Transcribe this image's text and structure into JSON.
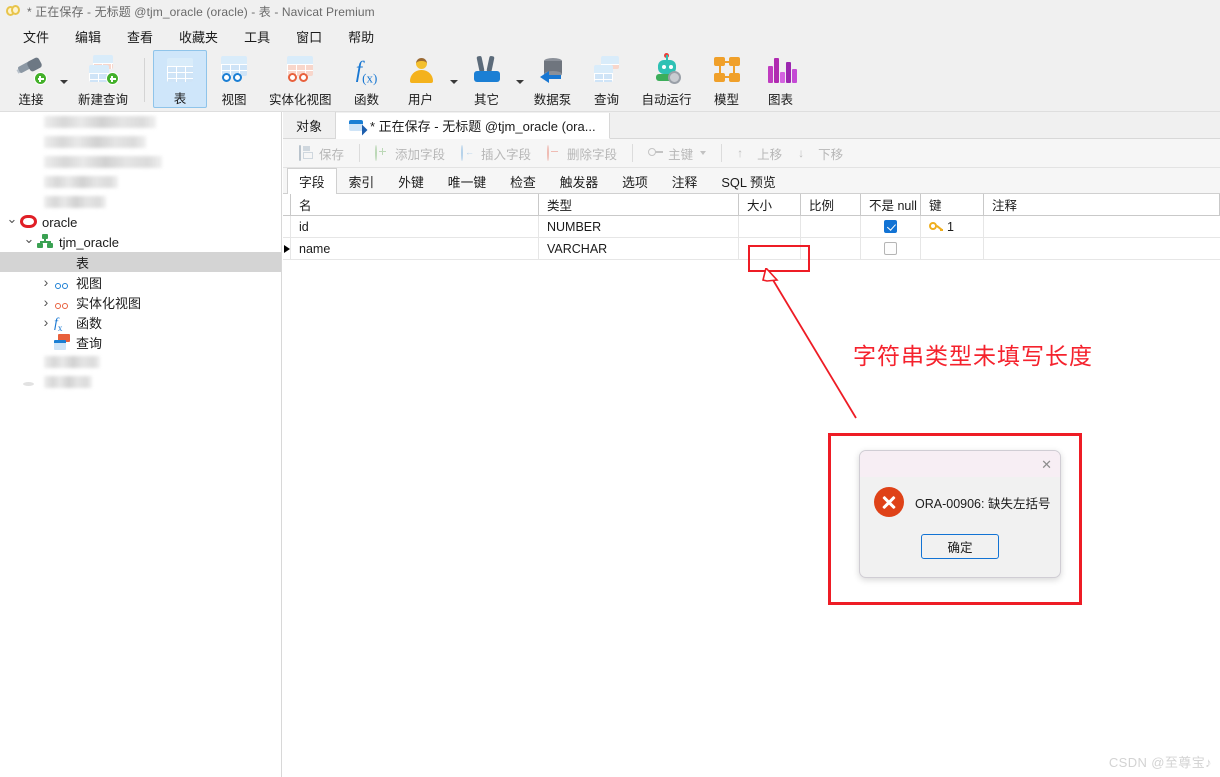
{
  "window": {
    "title": "* 正在保存 - 无标题 @tjm_oracle (oracle) - 表 - Navicat Premium",
    "logo_icon": "navicat-logo-icon"
  },
  "menubar": {
    "items": [
      {
        "label": "文件"
      },
      {
        "label": "编辑"
      },
      {
        "label": "查看"
      },
      {
        "label": "收藏夹"
      },
      {
        "label": "工具"
      },
      {
        "label": "窗口"
      },
      {
        "label": "帮助"
      }
    ]
  },
  "toolbar": {
    "items": [
      {
        "label": "连接",
        "icon": "connection-plug-icon",
        "caret": true,
        "active": false
      },
      {
        "label": "新建查询",
        "icon": "new-query-icon",
        "caret": false,
        "active": false
      },
      {
        "label": "表",
        "icon": "table-icon",
        "caret": false,
        "active": true
      },
      {
        "label": "视图",
        "icon": "view-goggles-icon",
        "caret": false,
        "active": false
      },
      {
        "label": "实体化视图",
        "icon": "materialized-view-icon",
        "caret": false,
        "active": false
      },
      {
        "label": "函数",
        "icon": "function-fx-icon",
        "caret": false,
        "active": false
      },
      {
        "label": "用户",
        "icon": "user-icon",
        "caret": true,
        "active": false
      },
      {
        "label": "其它",
        "icon": "tools-wrench-icon",
        "caret": true,
        "active": false
      },
      {
        "label": "数据泵",
        "icon": "data-pump-icon",
        "caret": false,
        "active": false
      },
      {
        "label": "查询",
        "icon": "query-icon",
        "caret": false,
        "active": false
      },
      {
        "label": "自动运行",
        "icon": "automation-robot-icon",
        "caret": false,
        "active": false
      },
      {
        "label": "模型",
        "icon": "model-diagram-icon",
        "caret": false,
        "active": false
      },
      {
        "label": "图表",
        "icon": "chart-bars-icon",
        "caret": false,
        "active": false
      }
    ]
  },
  "sidebar": {
    "items": [
      {
        "label": "",
        "icon": "mysql-icon",
        "indent": 0,
        "twisty": "",
        "blurred": true,
        "blur_width": 112,
        "selected": false
      },
      {
        "label": "",
        "icon": "mysql-icon",
        "indent": 0,
        "twisty": "",
        "blurred": true,
        "blur_width": 102,
        "selected": false
      },
      {
        "label": "",
        "icon": "mysql-icon",
        "indent": 0,
        "twisty": "",
        "blurred": true,
        "blur_width": 118,
        "selected": false
      },
      {
        "label": "",
        "icon": "mysql-icon",
        "indent": 0,
        "twisty": "",
        "blurred": true,
        "blur_width": 74,
        "selected": false
      },
      {
        "label": "",
        "icon": "postgresql-icon",
        "indent": 0,
        "twisty": "",
        "blurred": true,
        "blur_width": 62,
        "selected": false
      },
      {
        "label": "oracle",
        "icon": "oracle-icon",
        "indent": 0,
        "twisty": "down",
        "blurred": false,
        "selected": false
      },
      {
        "label": "tjm_oracle",
        "icon": "schema-icon",
        "indent": 1,
        "twisty": "down",
        "blurred": false,
        "selected": false
      },
      {
        "label": "表",
        "icon": "table-icon",
        "indent": 2,
        "twisty": "",
        "blurred": false,
        "selected": true
      },
      {
        "label": "视图",
        "icon": "view-icon",
        "indent": 2,
        "twisty": "right",
        "blurred": false,
        "selected": false
      },
      {
        "label": "实体化视图",
        "icon": "materialized-view-icon",
        "indent": 2,
        "twisty": "right",
        "blurred": false,
        "selected": false
      },
      {
        "label": "函数",
        "icon": "function-icon",
        "indent": 2,
        "twisty": "right",
        "blurred": false,
        "selected": false
      },
      {
        "label": "查询",
        "icon": "query-icon",
        "indent": 2,
        "twisty": "",
        "blurred": false,
        "selected": false
      },
      {
        "label": "",
        "icon": "mongodb-icon",
        "indent": 0,
        "twisty": "",
        "blurred": true,
        "blur_width": 56,
        "selected": false
      },
      {
        "label": "",
        "icon": "stack-icon",
        "indent": 0,
        "twisty": "",
        "blurred": true,
        "blur_width": 48,
        "selected": false
      }
    ]
  },
  "tabs": {
    "items": [
      {
        "label": "对象",
        "icon": "",
        "active": false
      },
      {
        "label": "* 正在保存 - 无标题 @tjm_oracle (ora...",
        "icon": "table-designer-icon",
        "active": true
      }
    ]
  },
  "editor_toolbar": {
    "items": [
      {
        "label": "保存",
        "icon": "save-icon",
        "caret": false
      },
      {
        "label": "添加字段",
        "icon": "add-field-icon",
        "caret": false
      },
      {
        "label": "插入字段",
        "icon": "insert-field-icon",
        "caret": false
      },
      {
        "label": "删除字段",
        "icon": "delete-field-icon",
        "caret": false
      },
      {
        "label": "主键",
        "icon": "primary-key-icon",
        "caret": true
      },
      {
        "label": "上移",
        "icon": "move-up-icon",
        "caret": false
      },
      {
        "label": "下移",
        "icon": "move-down-icon",
        "caret": false
      }
    ]
  },
  "subtabs": {
    "items": [
      {
        "label": "字段",
        "active": true
      },
      {
        "label": "索引",
        "active": false
      },
      {
        "label": "外键",
        "active": false
      },
      {
        "label": "唯一键",
        "active": false
      },
      {
        "label": "检查",
        "active": false
      },
      {
        "label": "触发器",
        "active": false
      },
      {
        "label": "选项",
        "active": false
      },
      {
        "label": "注释",
        "active": false
      },
      {
        "label": "SQL 预览",
        "active": false
      }
    ]
  },
  "grid": {
    "columns": [
      {
        "label": "名"
      },
      {
        "label": "类型"
      },
      {
        "label": "大小"
      },
      {
        "label": "比例"
      },
      {
        "label": "不是 null"
      },
      {
        "label": "键"
      },
      {
        "label": "注释"
      }
    ],
    "rows": [
      {
        "current": false,
        "name": "id",
        "type": "NUMBER",
        "size": "",
        "scale": "",
        "not_null": true,
        "key": "1",
        "comment": ""
      },
      {
        "current": true,
        "name": "name",
        "type": "VARCHAR",
        "size": "",
        "scale": "",
        "not_null": false,
        "key": "",
        "comment": ""
      }
    ]
  },
  "annotation": {
    "text": "字符串类型未填写长度",
    "color": "#f5222d"
  },
  "dialog": {
    "message": "ORA-00906: 缺失左括号",
    "ok_label": "确定",
    "close_label": "✕",
    "icon": "error-x-icon",
    "frame_color": "#ee1c25"
  },
  "watermark": {
    "text": "CSDN @至尊宝♪"
  }
}
